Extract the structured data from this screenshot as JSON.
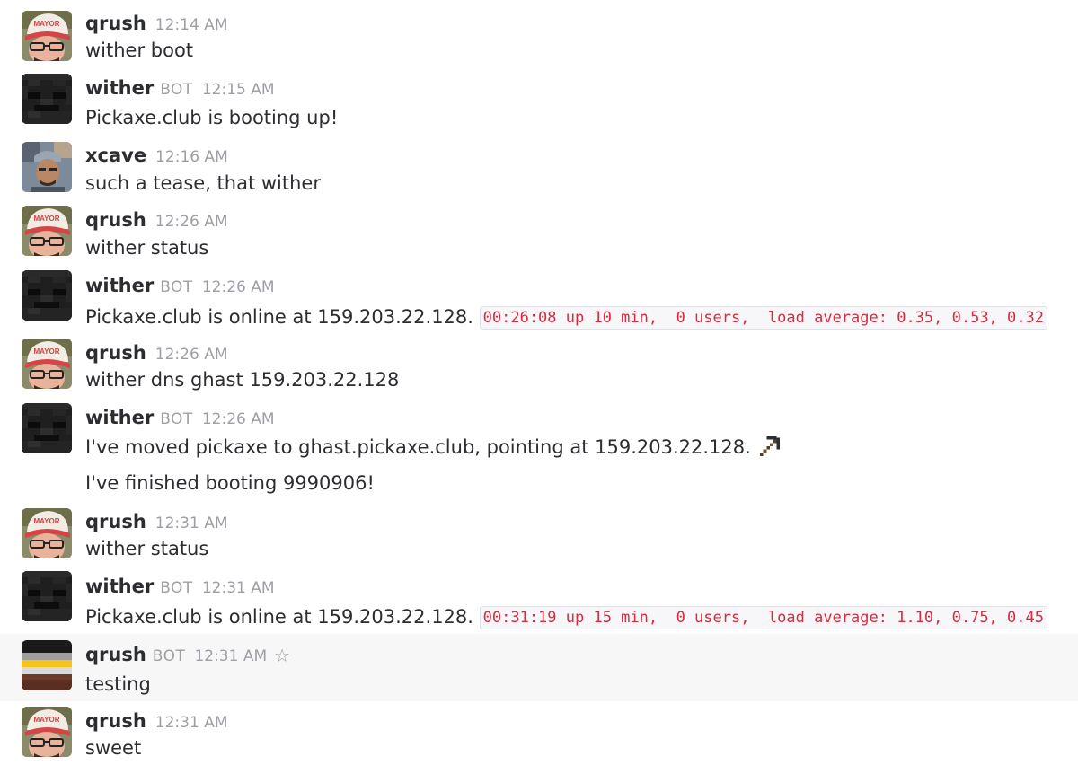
{
  "colors": {
    "code_text": "#d72b3f",
    "hover_row": "#f7f7f7",
    "muted": "#a0a0a2"
  },
  "messages": [
    {
      "user": "qrush",
      "time": "12:14 AM",
      "text": "wither boot",
      "avatar": "mayor-hat-avatar"
    },
    {
      "user": "wither",
      "badge": "BOT",
      "time": "12:15 AM",
      "text": "Pickaxe.club is booting up!",
      "avatar": "wither-skull-avatar"
    },
    {
      "user": "xcave",
      "time": "12:16 AM",
      "text": "such a tease, that wither",
      "avatar": "photo-avatar"
    },
    {
      "user": "qrush",
      "time": "12:26 AM",
      "text": "wither status",
      "avatar": "mayor-hat-avatar"
    },
    {
      "user": "wither",
      "badge": "BOT",
      "time": "12:26 AM",
      "text": "Pickaxe.club is online at 159.203.22.128.",
      "code": "00:26:08 up 10 min,  0 users,  load average: 0.35, 0.53, 0.32",
      "avatar": "wither-skull-avatar"
    },
    {
      "user": "qrush",
      "time": "12:26 AM",
      "text": "wither dns ghast 159.203.22.128",
      "avatar": "mayor-hat-avatar"
    },
    {
      "user": "wither",
      "badge": "BOT",
      "time": "12:26 AM",
      "text": "I've moved pickaxe to ghast.pickaxe.club, pointing at 159.203.22.128.",
      "emoji": "pickaxe-emoji",
      "text2": "I've finished booting 9990906!",
      "avatar": "wither-skull-avatar"
    },
    {
      "user": "qrush",
      "time": "12:31 AM",
      "text": "wither status",
      "avatar": "mayor-hat-avatar"
    },
    {
      "user": "wither",
      "badge": "BOT",
      "time": "12:31 AM",
      "text": "Pickaxe.club is online at 159.203.22.128.",
      "code": "00:31:19 up 15 min,  0 users,  load average: 1.10, 0.75, 0.45",
      "avatar": "wither-skull-avatar"
    },
    {
      "user": "qrush",
      "badge": "BOT",
      "time": "12:31 AM",
      "text": "testing",
      "avatar": "striped-avatar",
      "star": "star-icon",
      "highlighted": true
    },
    {
      "user": "qrush",
      "time": "12:31 AM",
      "text": "sweet",
      "avatar": "mayor-hat-avatar"
    }
  ]
}
